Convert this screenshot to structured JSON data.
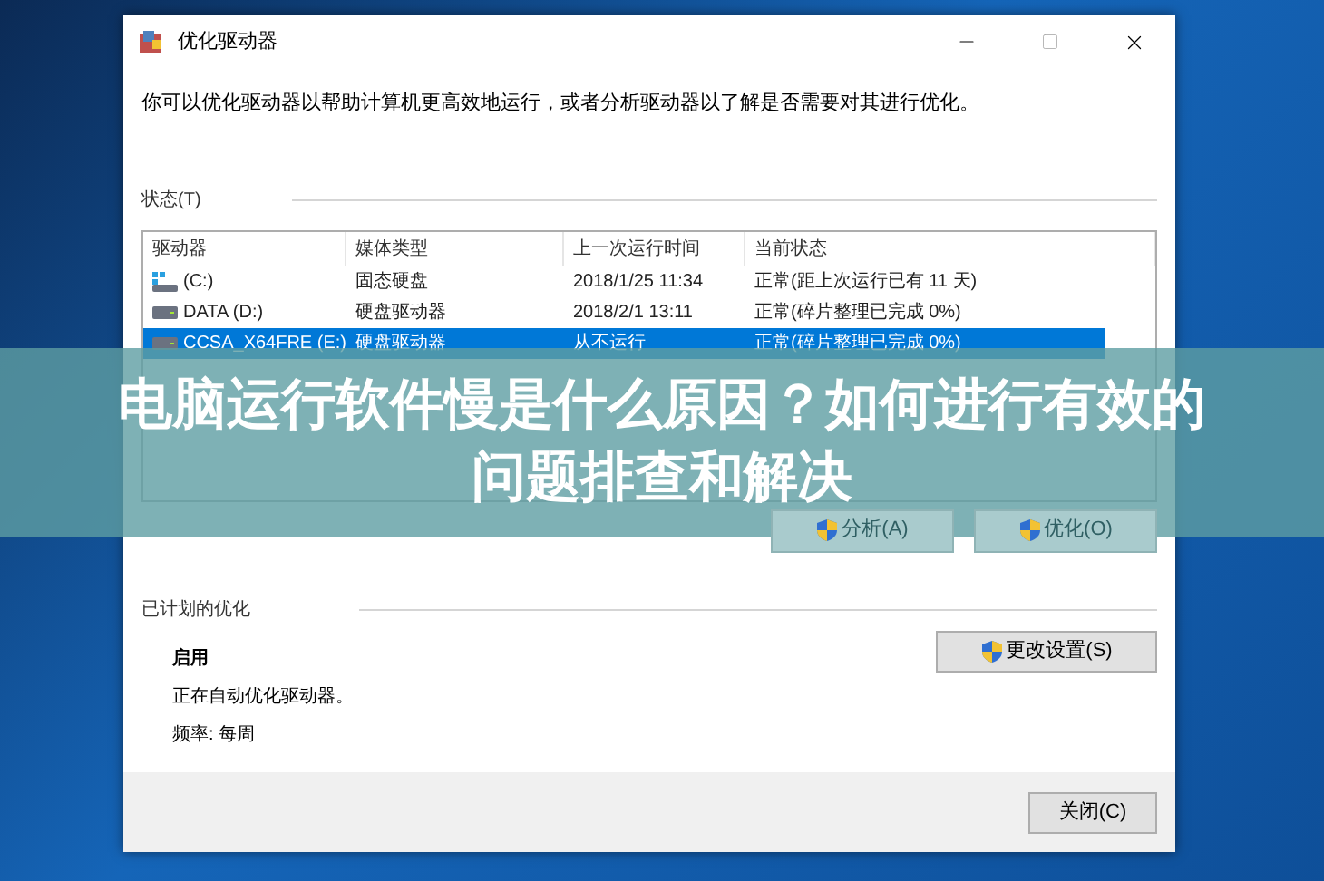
{
  "window": {
    "title": "优化驱动器",
    "description": "你可以优化驱动器以帮助计算机更高效地运行，或者分析驱动器以了解是否需要对其进行优化。",
    "status_section": {
      "label": "状态(T)",
      "table": {
        "columns": [
          "驱动器",
          "媒体类型",
          "上一次运行时间",
          "当前状态"
        ],
        "rows": [
          {
            "kind": "ssd",
            "drive": "(C:)",
            "media_type": "固态硬盘",
            "last_run": "2018/1/25 11:34",
            "status": "正常(距上次运行已有 11 天)",
            "selected": false
          },
          {
            "kind": "hdd",
            "drive": "DATA (D:)",
            "media_type": "硬盘驱动器",
            "last_run": "2018/2/1 13:11",
            "status": "正常(碎片整理已完成 0%)",
            "selected": false
          },
          {
            "kind": "hdd",
            "drive": "CCSA_X64FRE (E:)",
            "media_type": "硬盘驱动器",
            "last_run": "从不运行",
            "status": "正常(碎片整理已完成 0%)",
            "selected": true
          }
        ]
      },
      "actions": [
        "分析(A)",
        "优化(O)"
      ]
    },
    "scheduled": {
      "label": "已计划的优化",
      "state": "启用",
      "description": "正在自动优化驱动器。",
      "frequency": "频率: 每周",
      "button": "更改设置(S)"
    },
    "close_button": "关闭(C)"
  },
  "banner": {
    "title": "电脑运行软件慢是什么原因？如何进行有效的问题排查和解决"
  }
}
